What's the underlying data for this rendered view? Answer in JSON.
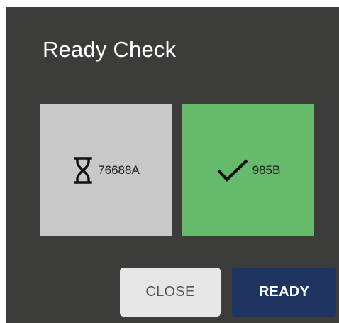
{
  "dialog": {
    "title": "Ready Check"
  },
  "participants": [
    {
      "id": "76688A",
      "status": "pending",
      "icon": "hourglass-icon",
      "color": "#c8c8c8"
    },
    {
      "id": "985B",
      "status": "ready",
      "icon": "checkmark-icon",
      "color": "#66ba6c"
    }
  ],
  "actions": {
    "close_label": "CLOSE",
    "ready_label": "READY"
  },
  "colors": {
    "dialog_background": "#3c3c3b",
    "ready_button": "#1d3560",
    "close_button": "#e6e6e6"
  }
}
